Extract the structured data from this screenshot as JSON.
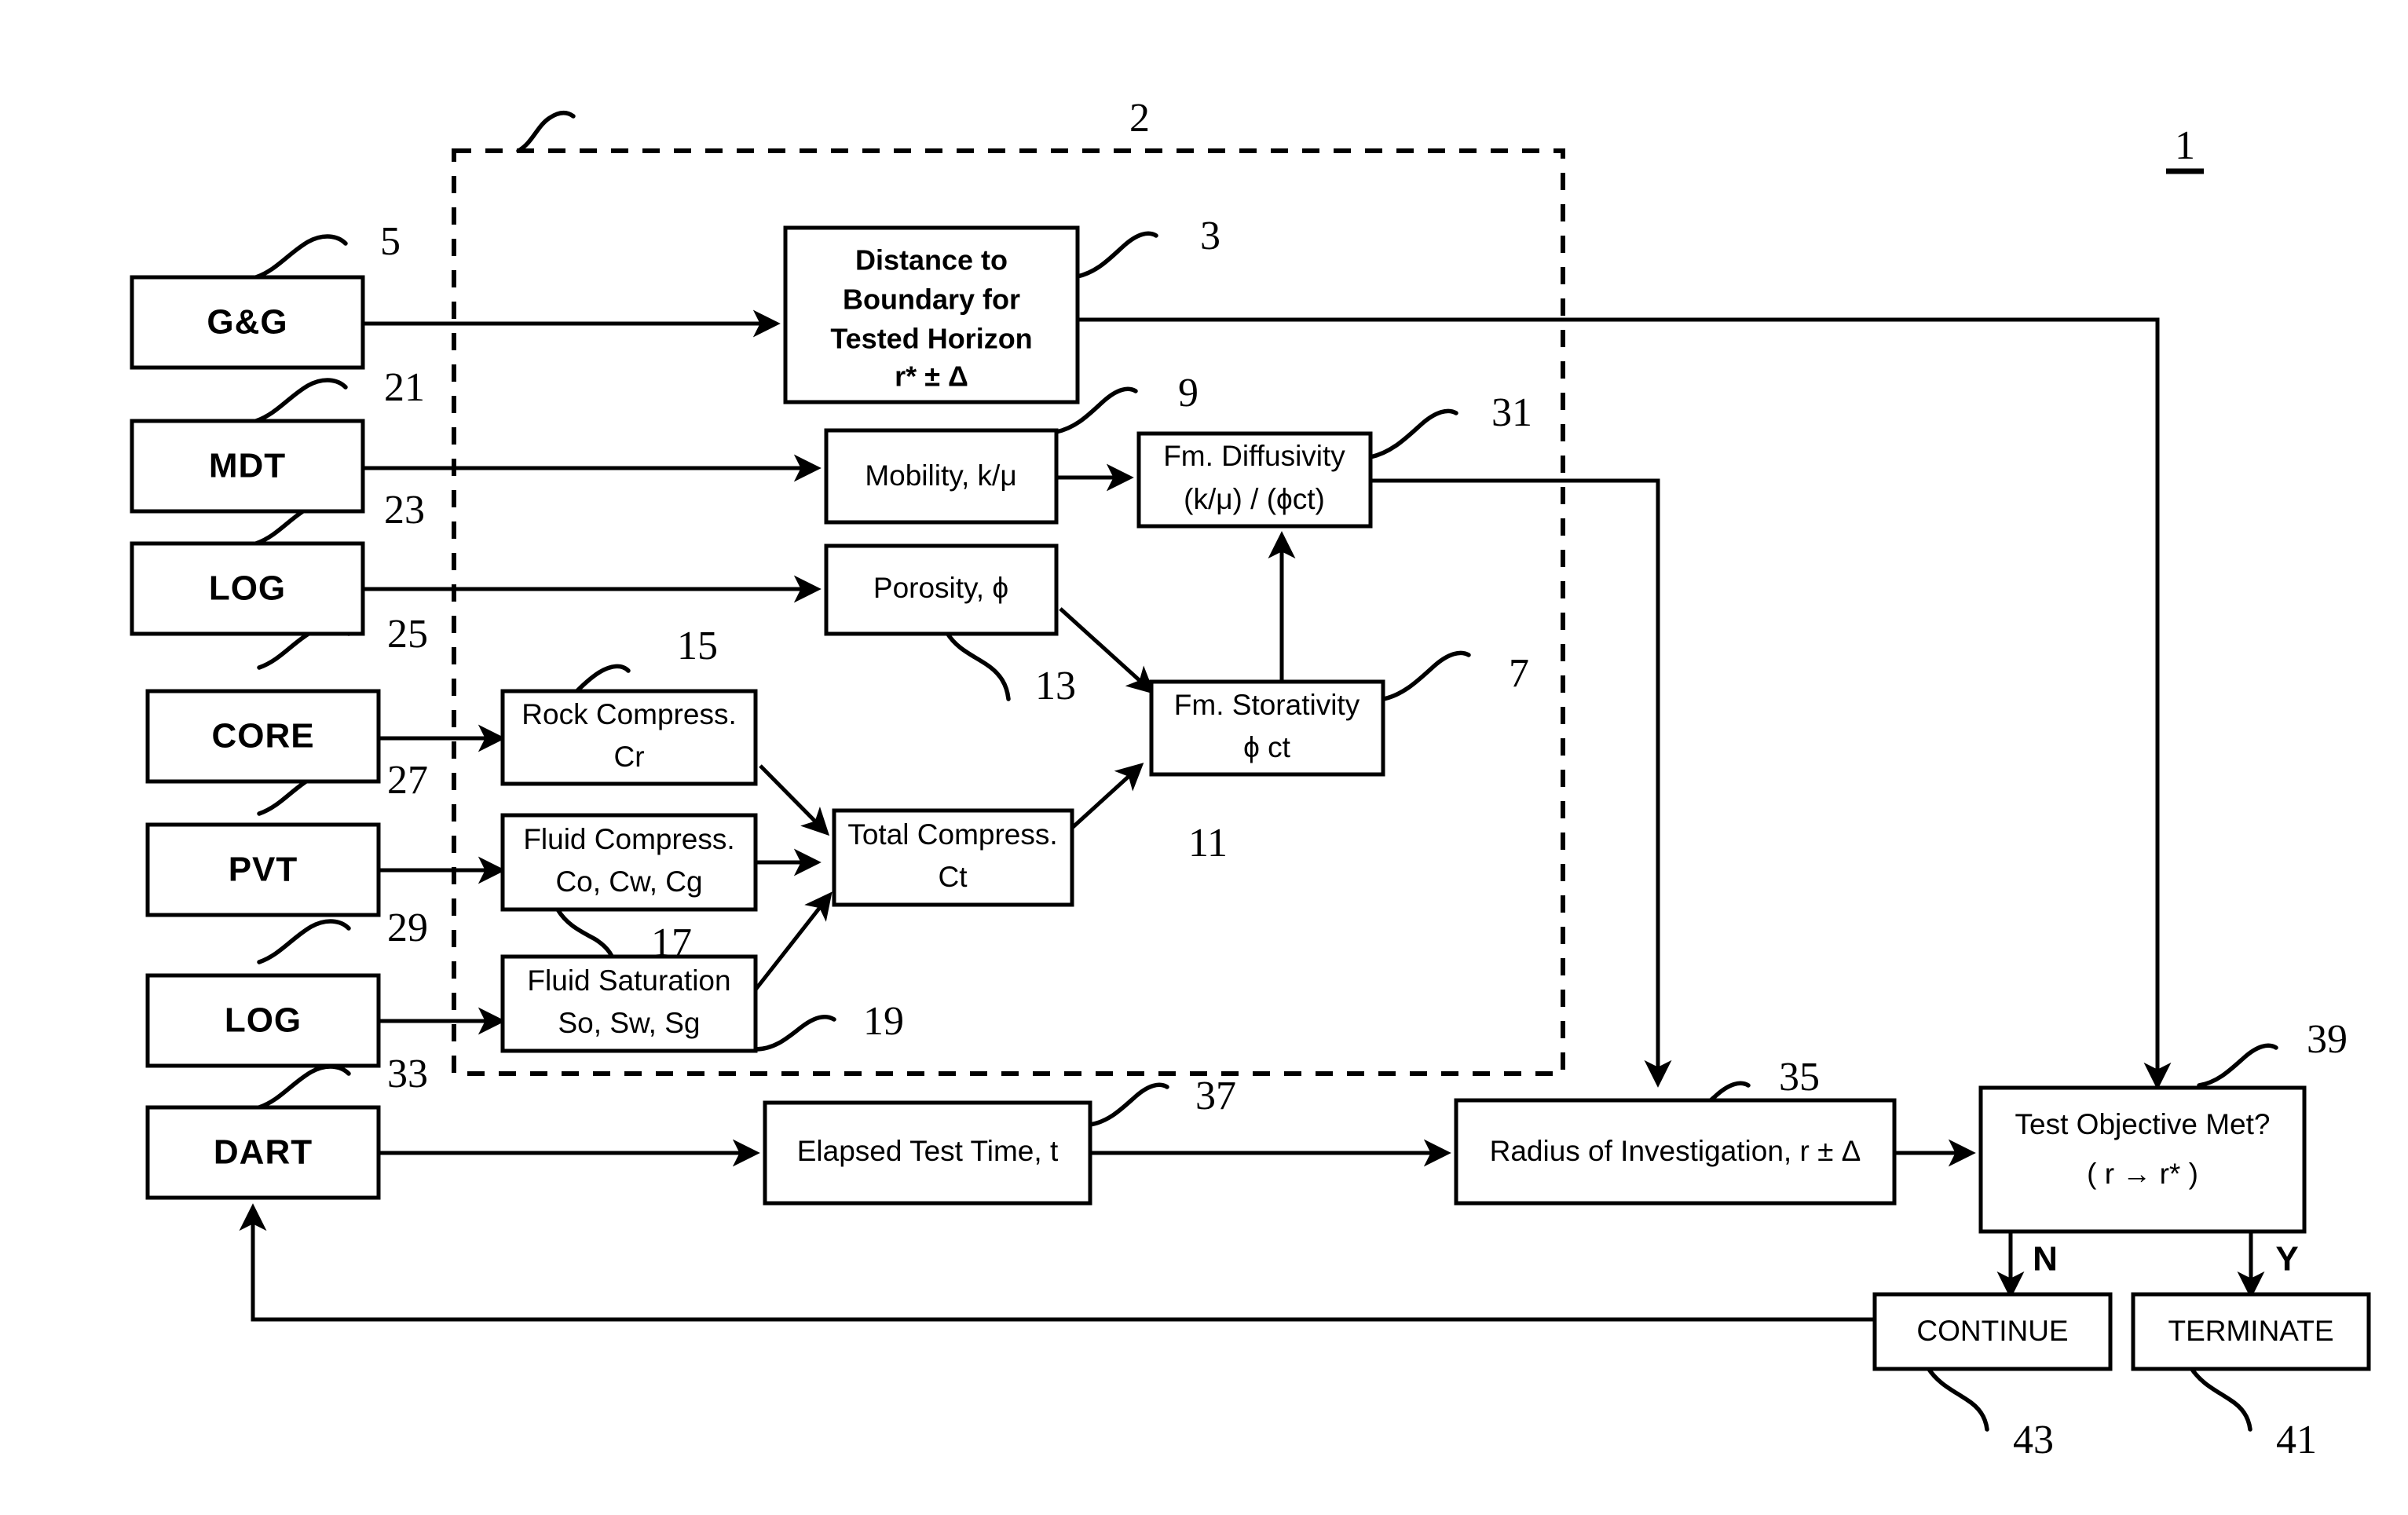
{
  "figure": {
    "number": "1",
    "region_label": "2",
    "type": "patent-flow-diagram"
  },
  "input_boxes": [
    {
      "id": "gg",
      "label": "G&G",
      "ref": "5"
    },
    {
      "id": "mdt",
      "label": "MDT",
      "ref": "21"
    },
    {
      "id": "log1",
      "label": "LOG",
      "ref": "23"
    },
    {
      "id": "core",
      "label": "CORE",
      "ref": "25"
    },
    {
      "id": "pvt",
      "label": "PVT",
      "ref": "27"
    },
    {
      "id": "log2",
      "label": "LOG",
      "ref": "29"
    },
    {
      "id": "dart",
      "label": "DART",
      "ref": "33"
    }
  ],
  "process_boxes": [
    {
      "id": "distance",
      "ref": "3",
      "lines": [
        "Distance to",
        "Boundary for",
        "Tested Horizon",
        "r* ± Δ"
      ],
      "bold": true
    },
    {
      "id": "mobility",
      "ref": "9",
      "lines": [
        "Mobility, k/μ"
      ],
      "bold": false
    },
    {
      "id": "diffusivity",
      "ref": "31",
      "lines": [
        "Fm. Diffusivity",
        "(k/μ) / (ϕct)"
      ],
      "bold": false
    },
    {
      "id": "porosity",
      "ref": "13",
      "lines": [
        "Porosity, ϕ"
      ],
      "bold": false
    },
    {
      "id": "storativity",
      "ref": "7",
      "lines": [
        "Fm. Storativity",
        "ϕ ct"
      ],
      "bold": false
    },
    {
      "id": "rock_compress",
      "ref": "15",
      "lines": [
        "Rock Compress.",
        "Cr"
      ],
      "bold": false
    },
    {
      "id": "fluid_compress",
      "ref": "17",
      "lines": [
        "Fluid Compress.",
        "Co, Cw, Cg"
      ],
      "bold": false
    },
    {
      "id": "fluid_saturation",
      "ref": "19",
      "lines": [
        "Fluid Saturation",
        "So, Sw, Sg"
      ],
      "bold": false
    },
    {
      "id": "total_compress",
      "ref": "11",
      "lines": [
        "Total Compress.",
        "Ct"
      ],
      "bold": false
    },
    {
      "id": "elapsed_time",
      "ref": "37",
      "lines": [
        "Elapsed Test Time, t"
      ],
      "bold": false
    },
    {
      "id": "radius",
      "ref": "35",
      "lines": [
        "Radius of Investigation, r ± Δ"
      ],
      "bold": false
    },
    {
      "id": "objective",
      "ref": "39",
      "lines": [
        "Test Objective Met?",
        "( r → r* )"
      ],
      "bold": false
    },
    {
      "id": "continue",
      "ref": "43",
      "lines": [
        "CONTINUE"
      ],
      "bold": false
    },
    {
      "id": "terminate",
      "ref": "41",
      "lines": [
        "TERMINATE"
      ],
      "bold": false
    }
  ],
  "branch_labels": {
    "no": "N",
    "yes": "Y"
  },
  "colors": {
    "line": "#000000",
    "background": "#ffffff",
    "text": "#000000"
  }
}
